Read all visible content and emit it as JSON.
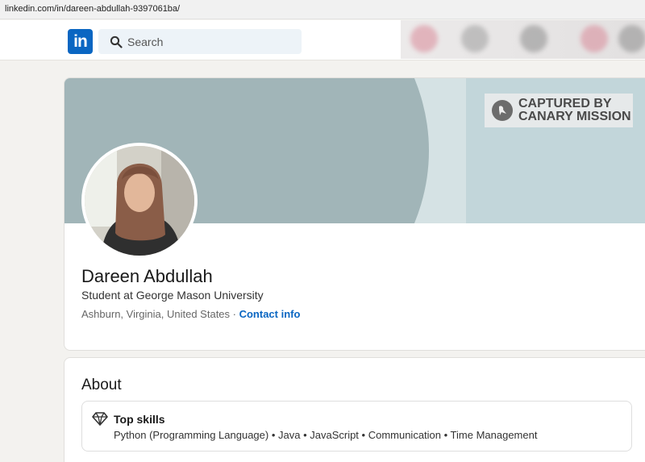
{
  "browser": {
    "url": "linkedin.com/in/dareen-abdullah-9397061ba/"
  },
  "navbar": {
    "logo_text": "in",
    "search_placeholder": "Search"
  },
  "banner": {
    "stamp_line1": "CAPTURED BY",
    "stamp_line2": "CANARY MISSION"
  },
  "profile": {
    "name": "Dareen Abdullah",
    "headline": "Student at George Mason University",
    "location": "Ashburn, Virginia, United States",
    "separator": " · ",
    "contact_label": "Contact info"
  },
  "about": {
    "title": "About",
    "top_skills_label": "Top skills",
    "skills": "Python (Programming Language) • Java • JavaScript • Communication • Time Management"
  },
  "colors": {
    "brand": "#0a66c2",
    "banner_circle": "#a1b5b8",
    "banner_right": "#c2d6da"
  }
}
